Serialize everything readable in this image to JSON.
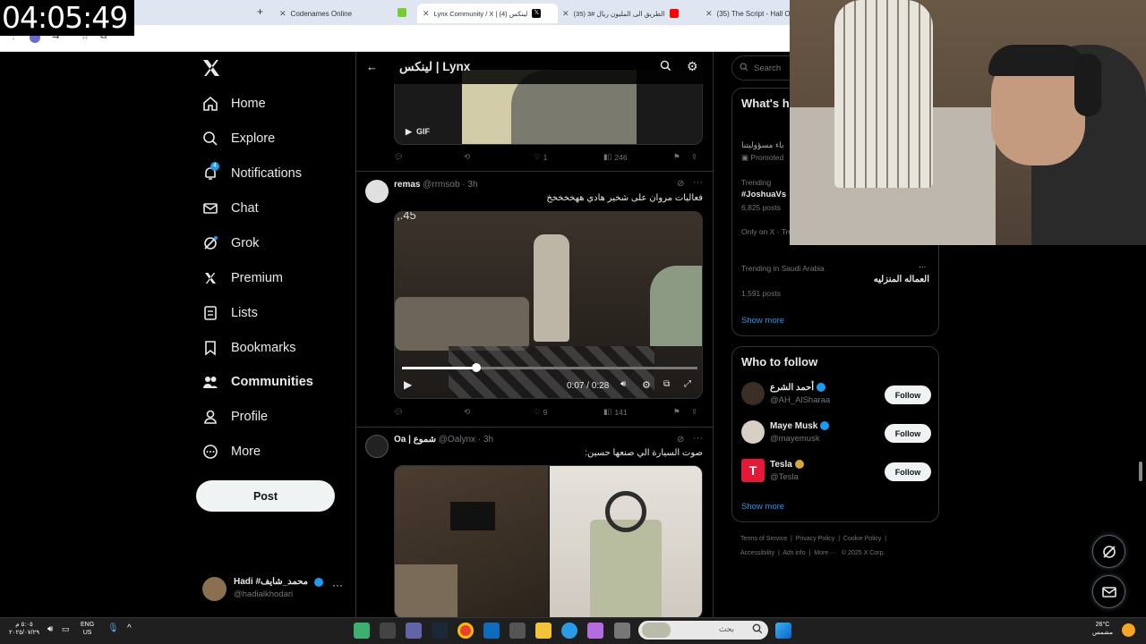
{
  "stream_clock": "04:05:49",
  "browser": {
    "tabs": [
      {
        "label": "Codenames Online",
        "active": false
      },
      {
        "label": "Lynx Community / X | (4) لينكس",
        "active": true
      },
      {
        "label": "(35) الطريق الى المليون ريال #3",
        "active": false
      },
      {
        "label": "(35) The Script - Hall O",
        "active": false
      }
    ],
    "new_tab": "+"
  },
  "nav": {
    "items": [
      {
        "label": "Home",
        "icon": "home-icon"
      },
      {
        "label": "Explore",
        "icon": "search-icon"
      },
      {
        "label": "Notifications",
        "icon": "bell-icon",
        "badge": "4"
      },
      {
        "label": "Chat",
        "icon": "mail-icon"
      },
      {
        "label": "Grok",
        "icon": "grok-icon"
      },
      {
        "label": "Premium",
        "icon": "x-icon"
      },
      {
        "label": "Lists",
        "icon": "list-icon"
      },
      {
        "label": "Bookmarks",
        "icon": "bookmark-icon"
      },
      {
        "label": "Communities",
        "icon": "communities-icon"
      },
      {
        "label": "Profile",
        "icon": "person-icon"
      },
      {
        "label": "More",
        "icon": "more-icon"
      }
    ],
    "active": "Communities",
    "post_label": "Post",
    "account": {
      "name": "Hadi #محمد_شايف",
      "handle": "@hadialkhodari"
    }
  },
  "center": {
    "header_title": "لينكس | Lynx",
    "tweet0": {
      "gif_label": "GIF",
      "likes": "1",
      "views": "246"
    },
    "tweet1": {
      "name": "remas",
      "handle": "@rrmsob",
      "time": "· 3h",
      "text": "فعاليات مروان على شخير هادي ههخخخخخ",
      "video_overlay": ",.45",
      "video_time": "0:07 / 0:28",
      "progress": 0.25,
      "likes": "9",
      "views": "141"
    },
    "tweet2": {
      "name": "Oa | شموع",
      "handle": "@Oalynx",
      "time": "· 3h",
      "text": "صوت السيارة الي صنعها حسين:"
    }
  },
  "right": {
    "search_placeholder": "Search",
    "whats_happening": {
      "title": "What's h",
      "promo_text": "باء مسؤوليتنا",
      "promoted": "Promoted",
      "trending_label": "Trending",
      "trend1": "#JoshuaVs",
      "trend1_posts": "6,825 posts",
      "only_on_x": "Only on X · Tre",
      "trend3_label": "Trending in Saudi Arabia",
      "trend3": "العماله المنزليه",
      "trend3_posts": "1,591 posts",
      "show_more": "Show more"
    },
    "who_to_follow": {
      "title": "Who to follow",
      "follow_label": "Follow",
      "accounts": [
        {
          "name": "أحمد الشرع",
          "handle": "@AH_AlSharaa",
          "badge": "#1d9bf0"
        },
        {
          "name": "Maye Musk",
          "handle": "@mayemusk",
          "badge": "#1d9bf0"
        },
        {
          "name": "Tesla",
          "handle": "@Tesla",
          "badge": "#d4a93a"
        }
      ],
      "show_more": "Show more"
    },
    "footer": {
      "line1": [
        "Terms of Service",
        "Privacy Policy",
        "Cookie Policy"
      ],
      "line2": [
        "Accessibility",
        "Ads info",
        "More ···",
        "© 2025 X Corp."
      ]
    }
  },
  "taskbar": {
    "time": "٥:٠٥ م",
    "date": "٢٠٢٥/٠٧/٢٩",
    "lang": "ENG",
    "region": "US",
    "search_placeholder": "بحث",
    "temp": "26°C",
    "weather": "مشمس"
  },
  "colors": {
    "accent": "#1d9bf0",
    "bg": "#000000",
    "border": "#2f3336",
    "muted": "#71767b"
  }
}
